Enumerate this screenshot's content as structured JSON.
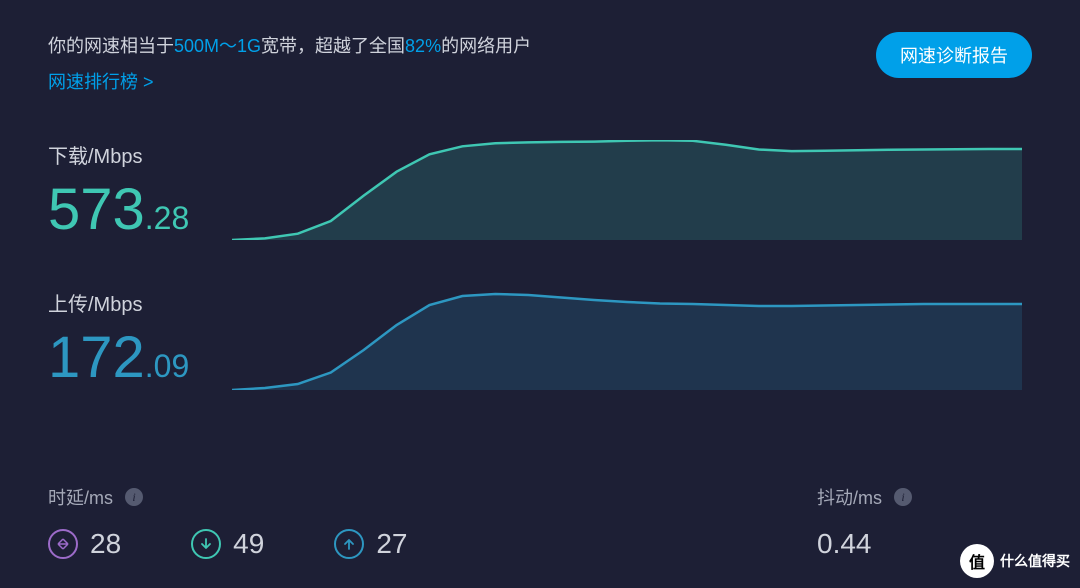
{
  "summary": {
    "prefix": "你的网速相当于",
    "bandwidth": "500M～1G",
    "mid": "宽带，超越了全国",
    "percent": "82%",
    "suffix": "的网络用户"
  },
  "rank_link": "网速排行榜 >",
  "report_button": "网速诊断报告",
  "download": {
    "label": "下载/Mbps",
    "int": "573",
    "frac": ".28"
  },
  "upload": {
    "label": "上传/Mbps",
    "int": "172",
    "frac": ".09"
  },
  "latency": {
    "label": "时延/ms",
    "idle": "28",
    "download": "49",
    "upload": "27"
  },
  "jitter": {
    "label": "抖动/ms",
    "value": "0.44"
  },
  "watermark": {
    "badge": "值",
    "text": "什么值得买"
  },
  "colors": {
    "download_stroke": "#3fc7b3",
    "download_fill": "rgba(63,199,179,0.18)",
    "upload_stroke": "#2d97c1",
    "upload_fill": "rgba(45,151,193,0.18)"
  },
  "chart_data": [
    {
      "type": "area",
      "name": "download",
      "ylabel": "Mbps",
      "ylim": [
        0,
        630
      ],
      "x": [
        0,
        1,
        2,
        3,
        4,
        5,
        6,
        7,
        8,
        9,
        10,
        11,
        12,
        13,
        14,
        15,
        16,
        17,
        18,
        19,
        20,
        21,
        22,
        23,
        24
      ],
      "values": [
        0,
        10,
        40,
        120,
        280,
        430,
        540,
        590,
        610,
        615,
        618,
        620,
        625,
        628,
        625,
        600,
        570,
        560,
        562,
        565,
        568,
        570,
        572,
        573,
        573
      ]
    },
    {
      "type": "area",
      "name": "upload",
      "ylabel": "Mbps",
      "ylim": [
        0,
        200
      ],
      "x": [
        0,
        1,
        2,
        3,
        4,
        5,
        6,
        7,
        8,
        9,
        10,
        11,
        12,
        13,
        14,
        15,
        16,
        17,
        18,
        19,
        20,
        21,
        22,
        23,
        24
      ],
      "values": [
        0,
        4,
        12,
        35,
        80,
        130,
        170,
        188,
        192,
        190,
        185,
        180,
        176,
        173,
        172,
        170,
        168,
        168,
        169,
        170,
        171,
        172,
        172,
        172,
        172
      ]
    }
  ]
}
